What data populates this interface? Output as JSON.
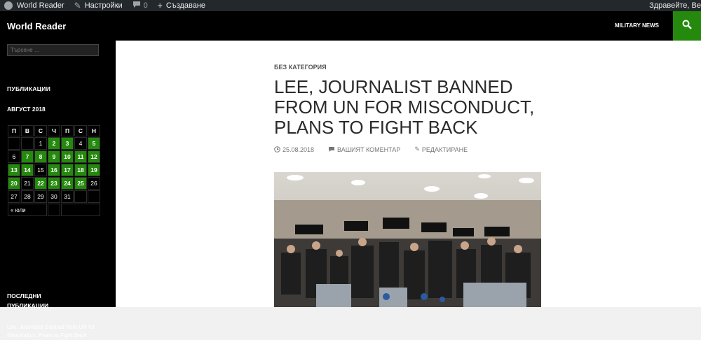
{
  "adminbar": {
    "site": "World Reader",
    "settings": "Настройки",
    "comments_count": "0",
    "new": "Създаване",
    "greeting": "Здравейте, Ве"
  },
  "header": {
    "site_title": "World Reader",
    "menu_item": "MILITARY NEWS",
    "search_icon": "search-icon"
  },
  "sidebar": {
    "search_placeholder": "Търсене …",
    "publications_title": "ПУБЛИКАЦИИ",
    "calendar": {
      "caption": "АВГУСТ 2018",
      "weekdays": [
        "П",
        "В",
        "С",
        "Ч",
        "П",
        "С",
        "Н"
      ],
      "weeks": [
        [
          "",
          "",
          "1",
          "2",
          "3",
          "4",
          "5"
        ],
        [
          "6",
          "7",
          "8",
          "9",
          "10",
          "11",
          "12"
        ],
        [
          "13",
          "14",
          "15",
          "16",
          "17",
          "18",
          "19"
        ],
        [
          "20",
          "21",
          "22",
          "23",
          "24",
          "25",
          "26"
        ],
        [
          "27",
          "28",
          "29",
          "30",
          "31",
          "",
          ""
        ]
      ],
      "linked_days": [
        "2",
        "3",
        "5",
        "7",
        "8",
        "9",
        "10",
        "11",
        "12",
        "13",
        "14",
        "16",
        "17",
        "18",
        "19",
        "20",
        "22",
        "23",
        "24",
        "25"
      ],
      "prev": "« юли"
    },
    "recent_title": "ПОСЛЕДНИ ПУБЛИКАЦИИ",
    "recent_post": "Lee, Journalist Banned from UN for Misconduct, Plans to Fight Back"
  },
  "post": {
    "category": "БЕЗ КАТЕГОРИЯ",
    "title": "LEE, JOURNALIST BANNED FROM UN FOR MISCONDUCT, PLANS TO FIGHT BACK",
    "date": "25.08.2018",
    "comment": "ВАШИЯТ КОМЕНТАР",
    "edit": "РЕДАКТИРАНЕ"
  },
  "colors": {
    "accent": "#24890d",
    "adminbar": "#23282d",
    "header": "#000000"
  }
}
